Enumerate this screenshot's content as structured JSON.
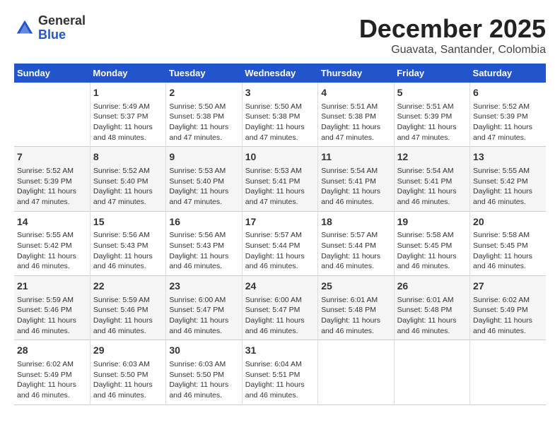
{
  "logo": {
    "general": "General",
    "blue": "Blue"
  },
  "title": "December 2025",
  "subtitle": "Guavata, Santander, Colombia",
  "days_header": [
    "Sunday",
    "Monday",
    "Tuesday",
    "Wednesday",
    "Thursday",
    "Friday",
    "Saturday"
  ],
  "weeks": [
    [
      {
        "num": "",
        "info": ""
      },
      {
        "num": "1",
        "info": "Sunrise: 5:49 AM\nSunset: 5:37 PM\nDaylight: 11 hours\nand 48 minutes."
      },
      {
        "num": "2",
        "info": "Sunrise: 5:50 AM\nSunset: 5:38 PM\nDaylight: 11 hours\nand 47 minutes."
      },
      {
        "num": "3",
        "info": "Sunrise: 5:50 AM\nSunset: 5:38 PM\nDaylight: 11 hours\nand 47 minutes."
      },
      {
        "num": "4",
        "info": "Sunrise: 5:51 AM\nSunset: 5:38 PM\nDaylight: 11 hours\nand 47 minutes."
      },
      {
        "num": "5",
        "info": "Sunrise: 5:51 AM\nSunset: 5:39 PM\nDaylight: 11 hours\nand 47 minutes."
      },
      {
        "num": "6",
        "info": "Sunrise: 5:52 AM\nSunset: 5:39 PM\nDaylight: 11 hours\nand 47 minutes."
      }
    ],
    [
      {
        "num": "7",
        "info": "Sunrise: 5:52 AM\nSunset: 5:39 PM\nDaylight: 11 hours\nand 47 minutes."
      },
      {
        "num": "8",
        "info": "Sunrise: 5:52 AM\nSunset: 5:40 PM\nDaylight: 11 hours\nand 47 minutes."
      },
      {
        "num": "9",
        "info": "Sunrise: 5:53 AM\nSunset: 5:40 PM\nDaylight: 11 hours\nand 47 minutes."
      },
      {
        "num": "10",
        "info": "Sunrise: 5:53 AM\nSunset: 5:41 PM\nDaylight: 11 hours\nand 47 minutes."
      },
      {
        "num": "11",
        "info": "Sunrise: 5:54 AM\nSunset: 5:41 PM\nDaylight: 11 hours\nand 46 minutes."
      },
      {
        "num": "12",
        "info": "Sunrise: 5:54 AM\nSunset: 5:41 PM\nDaylight: 11 hours\nand 46 minutes."
      },
      {
        "num": "13",
        "info": "Sunrise: 5:55 AM\nSunset: 5:42 PM\nDaylight: 11 hours\nand 46 minutes."
      }
    ],
    [
      {
        "num": "14",
        "info": "Sunrise: 5:55 AM\nSunset: 5:42 PM\nDaylight: 11 hours\nand 46 minutes."
      },
      {
        "num": "15",
        "info": "Sunrise: 5:56 AM\nSunset: 5:43 PM\nDaylight: 11 hours\nand 46 minutes."
      },
      {
        "num": "16",
        "info": "Sunrise: 5:56 AM\nSunset: 5:43 PM\nDaylight: 11 hours\nand 46 minutes."
      },
      {
        "num": "17",
        "info": "Sunrise: 5:57 AM\nSunset: 5:44 PM\nDaylight: 11 hours\nand 46 minutes."
      },
      {
        "num": "18",
        "info": "Sunrise: 5:57 AM\nSunset: 5:44 PM\nDaylight: 11 hours\nand 46 minutes."
      },
      {
        "num": "19",
        "info": "Sunrise: 5:58 AM\nSunset: 5:45 PM\nDaylight: 11 hours\nand 46 minutes."
      },
      {
        "num": "20",
        "info": "Sunrise: 5:58 AM\nSunset: 5:45 PM\nDaylight: 11 hours\nand 46 minutes."
      }
    ],
    [
      {
        "num": "21",
        "info": "Sunrise: 5:59 AM\nSunset: 5:46 PM\nDaylight: 11 hours\nand 46 minutes."
      },
      {
        "num": "22",
        "info": "Sunrise: 5:59 AM\nSunset: 5:46 PM\nDaylight: 11 hours\nand 46 minutes."
      },
      {
        "num": "23",
        "info": "Sunrise: 6:00 AM\nSunset: 5:47 PM\nDaylight: 11 hours\nand 46 minutes."
      },
      {
        "num": "24",
        "info": "Sunrise: 6:00 AM\nSunset: 5:47 PM\nDaylight: 11 hours\nand 46 minutes."
      },
      {
        "num": "25",
        "info": "Sunrise: 6:01 AM\nSunset: 5:48 PM\nDaylight: 11 hours\nand 46 minutes."
      },
      {
        "num": "26",
        "info": "Sunrise: 6:01 AM\nSunset: 5:48 PM\nDaylight: 11 hours\nand 46 minutes."
      },
      {
        "num": "27",
        "info": "Sunrise: 6:02 AM\nSunset: 5:49 PM\nDaylight: 11 hours\nand 46 minutes."
      }
    ],
    [
      {
        "num": "28",
        "info": "Sunrise: 6:02 AM\nSunset: 5:49 PM\nDaylight: 11 hours\nand 46 minutes."
      },
      {
        "num": "29",
        "info": "Sunrise: 6:03 AM\nSunset: 5:50 PM\nDaylight: 11 hours\nand 46 minutes."
      },
      {
        "num": "30",
        "info": "Sunrise: 6:03 AM\nSunset: 5:50 PM\nDaylight: 11 hours\nand 46 minutes."
      },
      {
        "num": "31",
        "info": "Sunrise: 6:04 AM\nSunset: 5:51 PM\nDaylight: 11 hours\nand 46 minutes."
      },
      {
        "num": "",
        "info": ""
      },
      {
        "num": "",
        "info": ""
      },
      {
        "num": "",
        "info": ""
      }
    ]
  ]
}
